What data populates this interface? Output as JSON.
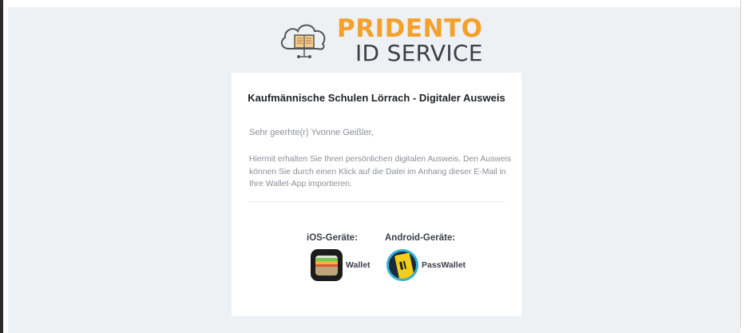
{
  "logo": {
    "brand_line1": "PRIDENTO",
    "brand_line2": "ID SERVICE",
    "icon": "cloud-book-icon",
    "primary_color": "#f4a02c",
    "secondary_color": "#3b4049"
  },
  "email": {
    "title": "Kaufmännische Schulen Lörrach - Digitaler Ausweis",
    "greeting": "Sehr geerhte(r) Yvonne Geißler,",
    "body": "Hiermit erhalten Sie Ihren persönlichen digitalen Ausweis. Den Ausweis können Sie durch einen Klick auf die Datei im Anhang dieser E-Mail in Ihre Wallet-App importieren.",
    "ios": {
      "label": "iOS-Geräte:",
      "app_name": "Wallet",
      "icon": "apple-wallet-icon"
    },
    "android": {
      "label": "Android-Geräte:",
      "app_name": "PassWallet",
      "icon": "passwallet-icon"
    }
  }
}
